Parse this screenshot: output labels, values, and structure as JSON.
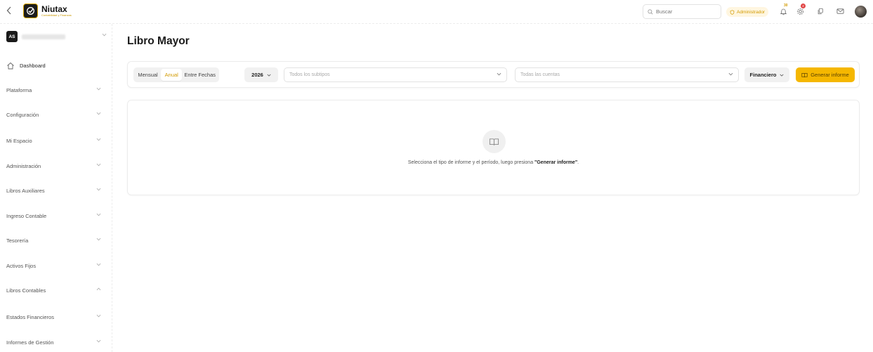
{
  "brand": {
    "name": "Niutax",
    "tagline": "Contabilidad y Finanzas"
  },
  "topbar": {
    "search_placeholder": "Buscar",
    "role_label": "Administrador",
    "notifications_count": "30",
    "alerts_count": "2"
  },
  "workspace": {
    "initials": "AS"
  },
  "sidebar": {
    "dashboard": "Dashboard",
    "items": [
      "Plataforma",
      "Configuración",
      "Mi Espacio",
      "Administración",
      "Libros Auxiliares",
      "Ingreso Contable",
      "Tesorería",
      "Activos Fijos",
      "Libros Contables",
      "Estados Financieros",
      "Informes de Gestión"
    ]
  },
  "page": {
    "title": "Libro Mayor"
  },
  "filters": {
    "periods": [
      "Mensual",
      "Anual",
      "Entre Fechas"
    ],
    "active_period": "Anual",
    "year": "2026",
    "subtypes_placeholder": "Todos los subtipos",
    "accounts_placeholder": "Todas las cuentas",
    "report_type": "Financiero",
    "generate_label": "Generar informe"
  },
  "empty_state": {
    "text_before": "Selecciona el tipo de informe y el período, luego presiona ",
    "text_bold": "\"Generar informe\"",
    "text_after": "."
  },
  "colors": {
    "accent": "#f5b700",
    "accent_text": "#d29a00"
  }
}
